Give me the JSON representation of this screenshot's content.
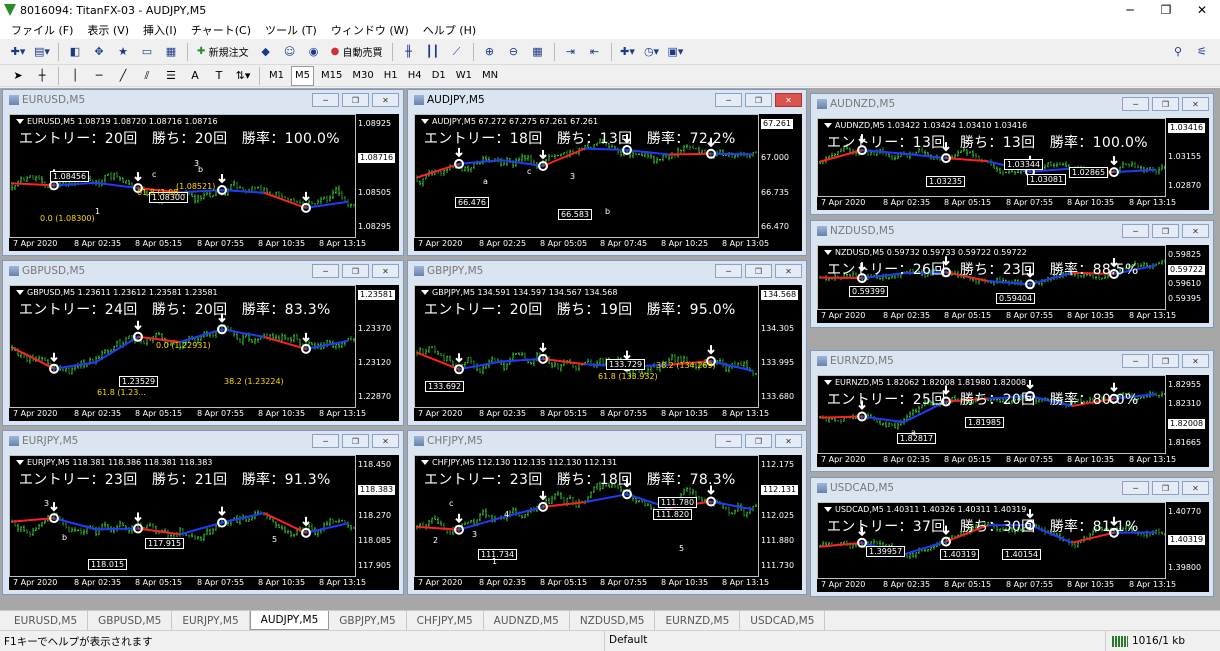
{
  "app": {
    "title": "8016094: TitanFX-03 - AUDJPY,M5"
  },
  "window_buttons": {
    "minimize": "─",
    "maximize": "❐",
    "close": "✕"
  },
  "menu": [
    "ファイル (F)",
    "表示 (V)",
    "挿入(I)",
    "チャート(C)",
    "ツール (T)",
    "ウィンドウ (W)",
    "ヘルプ (H)"
  ],
  "toolbar": {
    "new_order": "新規注文",
    "auto_trade": "自動売買"
  },
  "timeframes": [
    "M1",
    "M5",
    "M15",
    "M30",
    "H1",
    "H4",
    "D1",
    "W1",
    "MN"
  ],
  "icons": {
    "new_chart": "new-chart-icon",
    "profiles": "profiles-icon",
    "market_watch": "market-watch-icon",
    "crosshair": "crosshair-icon",
    "navigator": "navigator-icon",
    "terminal": "terminal-icon",
    "tester": "tester-icon",
    "new_order": "new-order-icon",
    "expert": "expert-icon",
    "bar_chart": "bar-chart-icon",
    "candles": "candles-icon",
    "line_chart": "line-chart-icon",
    "zoom_in": "zoom-in-icon",
    "zoom_out": "zoom-out-icon",
    "tile": "tile-icon",
    "autoscroll": "autoscroll-icon",
    "chart_shift": "chart-shift-icon",
    "indicators": "indicators-icon",
    "periods": "periods-icon",
    "templates": "templates-icon",
    "search": "search-icon",
    "options": "options-icon"
  },
  "windows": [
    {
      "title": "EURUSD,M5",
      "sym_line": "EURUSD,M5 1.08719 1.08720 1.08716 1.08716",
      "stats": "エントリー：20回　勝ち：20回　勝率：100.0%",
      "prices": [
        "1.08925",
        "1.08716",
        "1.08505",
        "1.08295"
      ],
      "current_price": "1.08716",
      "times": [
        "7 Apr 2020",
        "8 Apr 02:35",
        "8 Apr 05:15",
        "8 Apr 07:55",
        "8 Apr 10:35",
        "8 Apr 13:15"
      ],
      "labels": [
        "1.08300",
        "1.08456",
        "61.8 (1.08...",
        "0.0 (1.08300)",
        "(1.08521)",
        "1",
        "3",
        "c",
        "b"
      ]
    },
    {
      "title": "AUDJPY,M5",
      "sym_line": "AUDJPY,M5 67.272 67.275 67.261 67.261",
      "stats": "エントリー：18回　勝ち：13回　勝率：72.2%",
      "prices": [
        "67.261",
        "67.000",
        "66.735",
        "66.470"
      ],
      "current_price": "67.261",
      "times": [
        "7 Apr 2020",
        "8 Apr 02:25",
        "8 Apr 05:05",
        "8 Apr 07:45",
        "8 Apr 10:25",
        "8 Apr 13:05"
      ],
      "labels": [
        "66.476",
        "66.583",
        "3",
        "a",
        "b",
        "c"
      ]
    },
    {
      "title": "AUDNZD,M5",
      "sym_line": "AUDNZD,M5 1.03422 1.03424 1.03410 1.03416",
      "stats": "エントリー：13回　勝ち：13回　勝率：100.0%",
      "prices": [
        "1.03416",
        "1.03155",
        "1.02870"
      ],
      "current_price": "1.03416",
      "times": [
        "7 Apr 2020",
        "8 Apr 02:35",
        "8 Apr 05:15",
        "8 Apr 07:55",
        "8 Apr 10:35",
        "8 Apr 13:15"
      ],
      "labels": [
        "1.03081",
        "1.02865",
        "1.03344",
        "1.03235"
      ]
    },
    {
      "title": "GBPUSD,M5",
      "sym_line": "GBPUSD,M5 1.23611 1.23612 1.23581 1.23581",
      "stats": "エントリー：24回　勝ち：20回　勝率：83.3%",
      "prices": [
        "1.23581",
        "1.23370",
        "1.23120",
        "1.22870"
      ],
      "current_price": "1.23581",
      "times": [
        "7 Apr 2020",
        "8 Apr 02:35",
        "8 Apr 05:15",
        "8 Apr 07:55",
        "8 Apr 10:35",
        "8 Apr 13:15"
      ],
      "labels": [
        "1.23529",
        "61.8 (1.23...",
        "38.2 (1.23224)",
        "0.0 (1.22931)"
      ]
    },
    {
      "title": "GBPJPY,M5",
      "sym_line": "GBPJPY,M5 134.591 134.597 134.567 134.568",
      "stats": "エントリー：20回　勝ち：19回　勝率：95.0%",
      "prices": [
        "134.568",
        "134.305",
        "133.995",
        "133.680"
      ],
      "current_price": "134.568",
      "times": [
        "7 Apr 2020",
        "8 Apr 02:35",
        "8 Apr 05:15",
        "8 Apr 07:55",
        "8 Apr 10:35",
        "8 Apr 13:15"
      ],
      "labels": [
        "133.692",
        "133.729",
        "38.2 (134.269)",
        "61.8 (133.932)"
      ]
    },
    {
      "title": "NZDUSD,M5",
      "sym_line": "NZDUSD,M5 0.59732 0.59733 0.59722 0.59722",
      "stats": "エントリー：26回　勝ち：23回　勝率：88.5%",
      "prices": [
        "0.59825",
        "0.59722",
        "0.59610",
        "0.59395"
      ],
      "current_price": "0.59722",
      "times": [
        "7 Apr 2020",
        "8 Apr 02:35",
        "8 Apr 05:15",
        "8 Apr 07:55",
        "8 Apr 10:35",
        "8 Apr 13:15"
      ],
      "labels": [
        "0.59404",
        "0.59399"
      ]
    },
    {
      "title": "EURJPY,M5",
      "sym_line": "EURJPY,M5 118.381 118.386 118.381 118.383",
      "stats": "エントリー：23回　勝ち：21回　勝率：91.3%",
      "prices": [
        "118.450",
        "118.383",
        "118.270",
        "118.085",
        "117.905"
      ],
      "current_price": "118.383",
      "times": [
        "7 Apr 2020",
        "8 Apr 02:35",
        "8 Apr 05:15",
        "8 Apr 07:55",
        "8 Apr 10:35",
        "8 Apr 13:15"
      ],
      "labels": [
        "118.015",
        "117.915",
        "3",
        "5",
        "b"
      ]
    },
    {
      "title": "CHFJPY,M5",
      "sym_line": "CHFJPY,M5 112.130 112.135 112.130 112.131",
      "stats": "エントリー：23回　勝ち：18回　勝率：78.3%",
      "prices": [
        "112.175",
        "112.131",
        "112.025",
        "111.880",
        "111.730"
      ],
      "current_price": "112.131",
      "times": [
        "7 Apr 2020",
        "8 Apr 02:35",
        "8 Apr 05:15",
        "8 Apr 07:55",
        "8 Apr 10:35",
        "8 Apr 13:15"
      ],
      "labels": [
        "111.780",
        "111.820",
        "111.734",
        "c",
        "1",
        "2",
        "3",
        "4",
        "5"
      ]
    },
    {
      "title": "EURNZD,M5",
      "sym_line": "EURNZD,M5 1.82062 1.82008 1.81980 1.82008",
      "stats": "エントリー：25回　勝ち：20回　勝率：80.0%",
      "prices": [
        "1.82955",
        "1.82310",
        "1.82008",
        "1.81665"
      ],
      "current_price": "1.82008",
      "times": [
        "7 Apr 2020",
        "8 Apr 02:35",
        "8 Apr 05:15",
        "8 Apr 07:55",
        "8 Apr 10:35",
        "8 Apr 13:15"
      ],
      "labels": [
        "1.81985",
        "1.82817",
        "a"
      ]
    },
    {
      "title": "USDCAD,M5",
      "sym_line": "USDCAD,M5 1.40311 1.40326 1.40311 1.40319",
      "stats": "エントリー：37回　勝ち：30回　勝率：81.1%",
      "prices": [
        "1.40770",
        "1.40319",
        "1.39800"
      ],
      "current_price": "1.40319",
      "times": [
        "7 Apr 2020",
        "8 Apr 02:35",
        "8 Apr 05:15",
        "8 Apr 07:55",
        "8 Apr 10:35",
        "8 Apr 13:15"
      ],
      "labels": [
        "1.39957",
        "1.40154",
        "1.40319"
      ]
    }
  ],
  "tabs": [
    "EURUSD,M5",
    "GBPUSD,M5",
    "EURJPY,M5",
    "AUDJPY,M5",
    "GBPJPY,M5",
    "CHFJPY,M5",
    "AUDNZD,M5",
    "NZDUSD,M5",
    "EURNZD,M5",
    "USDCAD,M5"
  ],
  "active_tab": 3,
  "status": {
    "help": "F1キーでヘルプが表示されます",
    "profile": "Default",
    "connection": "1016/1 kb"
  },
  "colors": {
    "bg": "#000000",
    "up": "#32cd32",
    "down": "#ff3b3b",
    "zig": "#1e3cff",
    "zig2": "#ff2020",
    "axis": "#ffffff"
  }
}
